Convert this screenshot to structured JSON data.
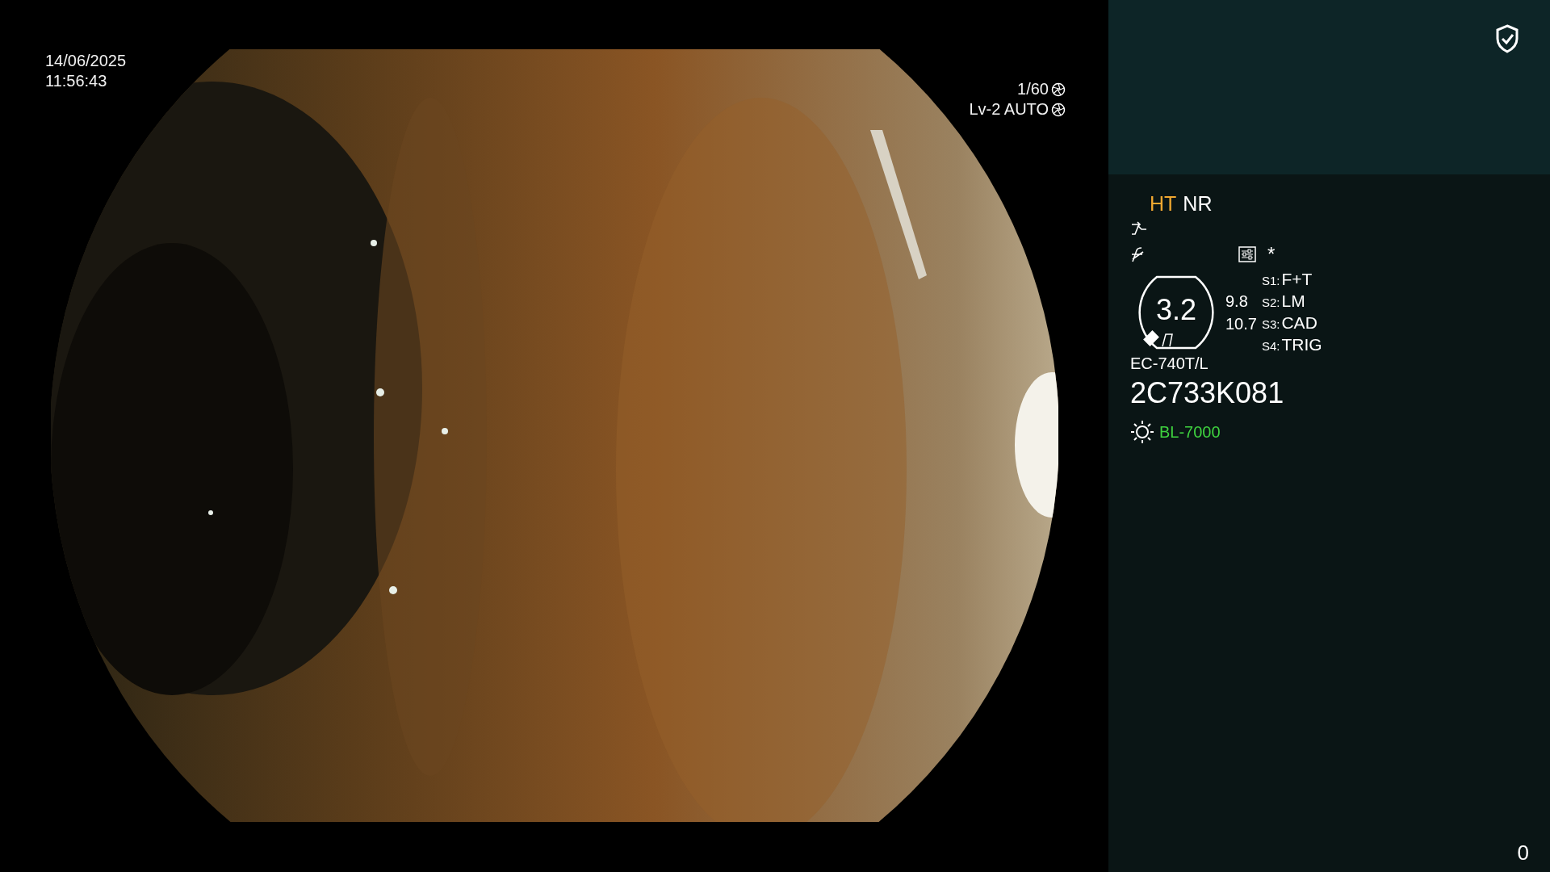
{
  "datetime": {
    "date": "14/06/2025",
    "time": "11:56:43"
  },
  "exposure": {
    "shutter": "1/60",
    "mode": "Lv-2 AUTO"
  },
  "panel": {
    "modes": [
      {
        "label": "HT",
        "color": "#f0a830"
      },
      {
        "label": "NR",
        "color": "#ffffff"
      }
    ],
    "marker": "*",
    "gauge": {
      "value": "3.2",
      "readings": [
        "9.8",
        "10.7"
      ]
    },
    "switches": [
      {
        "key": "S1:",
        "value": "F+T"
      },
      {
        "key": "S2:",
        "value": "LM"
      },
      {
        "key": "S3:",
        "value": "CAD"
      },
      {
        "key": "S4:",
        "value": "TRIG"
      }
    ],
    "scope_model": "EC-740T/L",
    "serial": "2C733K081",
    "light_source": "BL-7000",
    "counter": "0"
  }
}
